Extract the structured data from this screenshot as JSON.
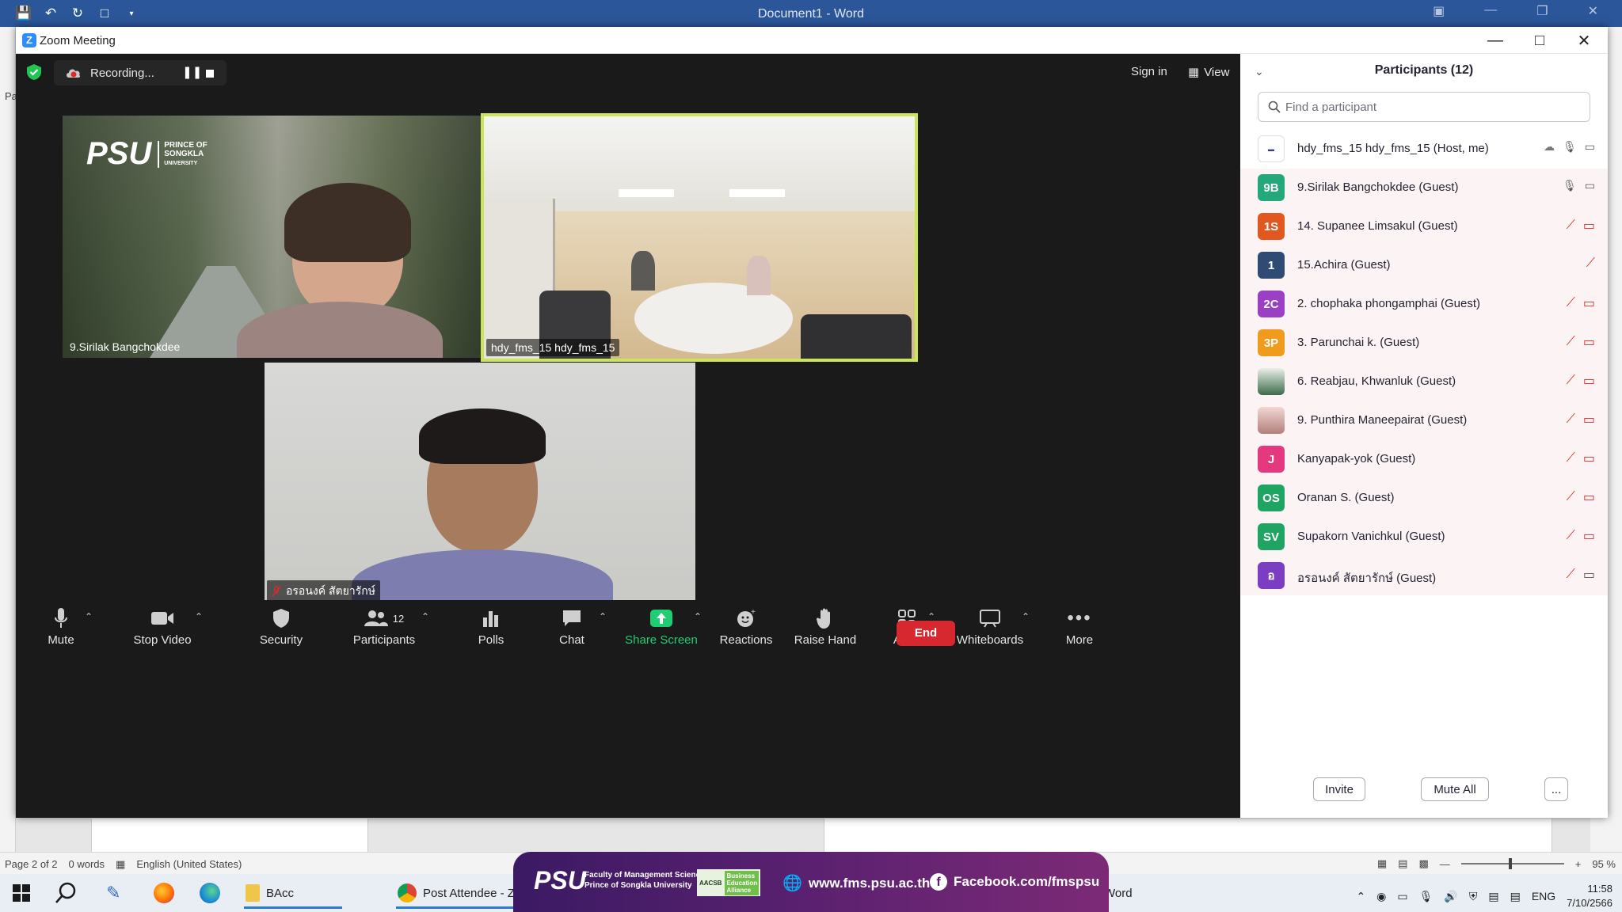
{
  "word": {
    "title": "Document1 - Word",
    "status_page": "Page 2 of 2",
    "status_words": "0 words",
    "status_lang": "English (United States)",
    "zoom_level": "95 %",
    "left_fragment": "Pa",
    "taskbar_fragment": "Word"
  },
  "zoom": {
    "window_title": "Zoom Meeting",
    "recording_label": "Recording...",
    "sign_in": "Sign in",
    "view": "View",
    "tiles": [
      {
        "name": "9.Sirilak Bangchokdee"
      },
      {
        "name": "hdy_fms_15 hdy_fms_15"
      },
      {
        "name": "อรอนงค์ สัตยารักษ์"
      }
    ],
    "tile1_logo": {
      "psu": "PSU",
      "line1": "PRINCE OF",
      "line2": "SONGKLA",
      "line3": "UNIVERSITY"
    },
    "toolbar": {
      "mute": "Mute",
      "stop_video": "Stop Video",
      "security": "Security",
      "participants": "Participants",
      "participants_count": "12",
      "polls": "Polls",
      "chat": "Chat",
      "share_screen": "Share Screen",
      "reactions": "Reactions",
      "raise_hand": "Raise Hand",
      "apps": "Apps",
      "whiteboards": "Whiteboards",
      "more": "More",
      "end": "End"
    },
    "panel": {
      "title": "Participants (12)",
      "search_placeholder": "Find a participant",
      "participants": [
        {
          "initials": "",
          "name": "hdy_fms_15 hdy_fms_15 (Host, me)",
          "color": "#ffffff"
        },
        {
          "initials": "9B",
          "name": "9.Sirilak Bangchokdee (Guest)",
          "color": "#23a77b"
        },
        {
          "initials": "1S",
          "name": "14. Supanee Limsakul (Guest)",
          "color": "#e0571f"
        },
        {
          "initials": "1",
          "name": "15.Achira (Guest)",
          "color": "#2f4a73"
        },
        {
          "initials": "2C",
          "name": "2. chophaka phongamphai (Guest)",
          "color": "#9b40c4"
        },
        {
          "initials": "3P",
          "name": "3. Parunchai k. (Guest)",
          "color": "#f09b1d"
        },
        {
          "initials": "",
          "name": "6. Reabjau, Khwanluk (Guest)",
          "color": "#3d6b4a"
        },
        {
          "initials": "",
          "name": "9. Punthira Maneepairat (Guest)",
          "color": "#d3a6a3"
        },
        {
          "initials": "J",
          "name": "Kanyapak-yok (Guest)",
          "color": "#e4387f"
        },
        {
          "initials": "OS",
          "name": "Oranan S. (Guest)",
          "color": "#1fa462"
        },
        {
          "initials": "SV",
          "name": "Supakorn Vanichkul (Guest)",
          "color": "#1fa462"
        },
        {
          "initials": "อ",
          "name": "อรอนงค์ สัตยารักษ์ (Guest)",
          "color": "#7b3ec2"
        }
      ],
      "invite": "Invite",
      "mute_all": "Mute All",
      "more": "..."
    }
  },
  "taskbar": {
    "app_bacc": "BAcc",
    "app_chrome": "Post Attendee - Zo",
    "tray_lang": "ENG",
    "time": "11:58",
    "date": "7/10/2566"
  },
  "banner": {
    "psu": "PSU",
    "fms_line1": "Faculty of Management Sciences",
    "fms_line2": "Prince of Songkla University",
    "aacsb": "AACSB",
    "aacsb_alliance_1": "Business",
    "aacsb_alliance_2": "Education",
    "aacsb_alliance_3": "Alliance",
    "website": "www.fms.psu.ac.th",
    "facebook": "Facebook.com/fmspsu"
  }
}
